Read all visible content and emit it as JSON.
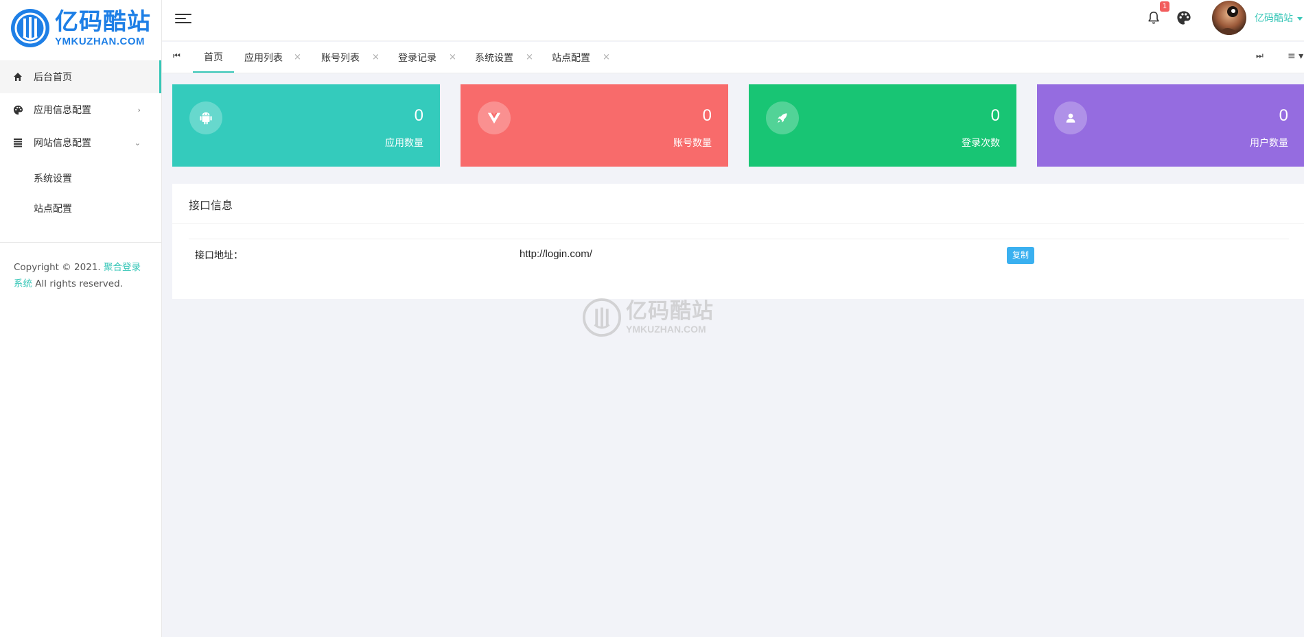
{
  "brand": {
    "cn": "亿码酷站",
    "en": "YMKUZHAN.COM",
    "color": "#1e7fe6"
  },
  "accent": "#36c6b7",
  "sidebar": {
    "items": [
      {
        "label": "后台首页",
        "icon": "home-icon",
        "active": true
      },
      {
        "label": "应用信息配置",
        "icon": "palette-icon",
        "arrow": "›"
      },
      {
        "label": "网站信息配置",
        "icon": "list-icon",
        "arrow": "⌄"
      }
    ],
    "subitems": [
      {
        "label": "系统设置"
      },
      {
        "label": "站点配置"
      }
    ],
    "copyright": {
      "prefix": "Copyright © 2021. ",
      "link": "聚合登录系统",
      "suffix": " All rights reserved."
    }
  },
  "header": {
    "notification_count": "1",
    "username": "亿码酷站"
  },
  "tabs": {
    "first_icon": "⏮",
    "last_icon": "⏭",
    "menu_icon": "≡ ▾",
    "items": [
      {
        "label": "首页",
        "active": true
      },
      {
        "label": "应用列表",
        "close": "×"
      },
      {
        "label": "账号列表",
        "close": "×"
      },
      {
        "label": "登录记录",
        "close": "×"
      },
      {
        "label": "系统设置",
        "close": "×"
      },
      {
        "label": "站点配置",
        "close": "×"
      }
    ]
  },
  "stats": [
    {
      "value": "0",
      "label": "应用数量",
      "icon": "android-icon",
      "color": "#34cbbc"
    },
    {
      "value": "0",
      "label": "账号数量",
      "icon": "vue-icon",
      "color": "#f86b6b"
    },
    {
      "value": "0",
      "label": "登录次数",
      "icon": "rocket-icon",
      "color": "#18c574"
    },
    {
      "value": "0",
      "label": "用户数量",
      "icon": "user-icon",
      "color": "#956ce0"
    }
  ],
  "api_panel": {
    "title": "接口信息",
    "label": "接口地址：",
    "value": "http://login.com/",
    "copy_button": "复制"
  },
  "watermark": {
    "cn": "亿码酷站",
    "en": "YMKUZHAN.COM"
  }
}
